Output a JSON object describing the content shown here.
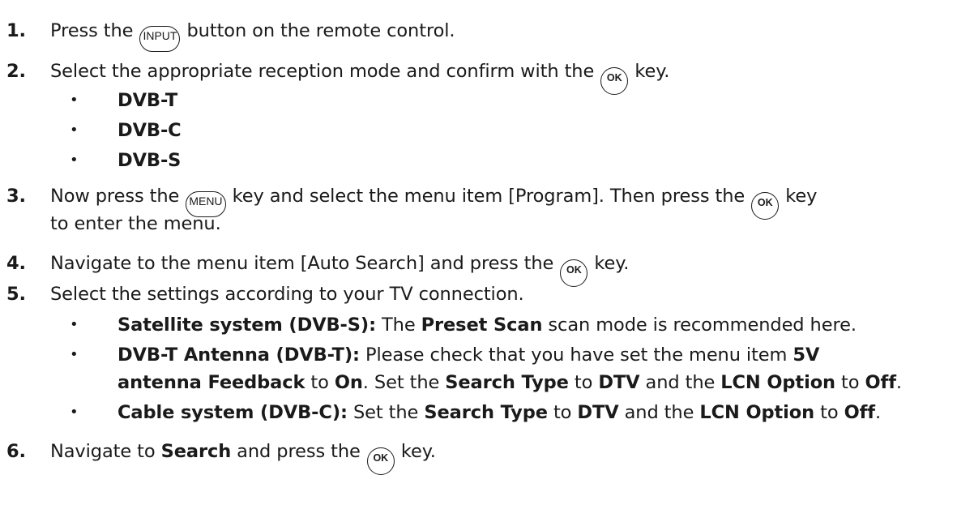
{
  "steps": [
    {
      "number": "1.",
      "before": "Press the ",
      "key": "INPUT",
      "after": " button on the remote control."
    },
    {
      "number": "2.",
      "before": "Select the appropriate reception mode and confirm with the ",
      "key": "OK",
      "after": " key.",
      "bullets": [
        "DVB-T",
        "DVB-C",
        "DVB-S"
      ]
    },
    {
      "number": "3.",
      "before": "Now press the ",
      "key": "MENU",
      "middle": " key and select the menu item [Program]. Then press the ",
      "key2": "OK",
      "after": " key",
      "continuation": "to enter the menu."
    },
    {
      "number": "4.",
      "before": "Navigate to the menu item [Auto Search] and press the ",
      "key": "OK",
      "after": " key."
    },
    {
      "number": "5.",
      "text": "Select the settings according to your TV connection.",
      "bullets": [
        {
          "b1": "Satellite system (DVB-S):",
          "t1": " The ",
          "b2": "Preset Scan",
          "t2": " scan mode is recommended here."
        },
        {
          "b1": "DVB-T Antenna (DVB-T):",
          "t1": " Please check that you have set the menu item ",
          "b2": "5V",
          "line2": {
            "b1": "antenna Feedback",
            "t1": " to ",
            "b2": "On",
            "t2": ". Set the ",
            "b3": "Search Type",
            "t3": " to ",
            "b4": "DTV",
            "t4": " and the ",
            "b5": "LCN Option",
            "t5": " to ",
            "b6": "Off",
            "t6": "."
          }
        },
        {
          "b1": "Cable system (DVB-C):",
          "t1": " Set the ",
          "b2": "Search Type",
          "t2": " to ",
          "b3": "DTV",
          "t3": " and the ",
          "b4": "LCN Option",
          "t4": " to ",
          "b5": "Off",
          "t5": "."
        }
      ]
    },
    {
      "number": "6.",
      "before": "Navigate to ",
      "bold": "Search",
      "middle": " and press the ",
      "key": "OK",
      "after": " key."
    }
  ],
  "bullet_glyph": "•"
}
